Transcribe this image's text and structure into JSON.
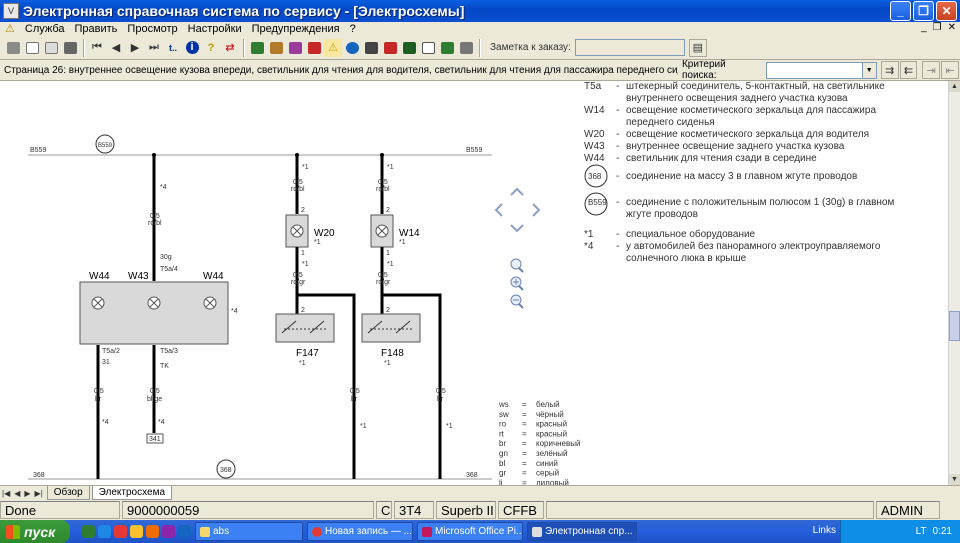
{
  "window": {
    "app_icon": "V",
    "title": "Электронная справочная система по сервису - [Электросхемы]",
    "minimize": "_",
    "restore": "❐",
    "close": "✕"
  },
  "menu": {
    "items": [
      "Служба",
      "Править",
      "Просмотр",
      "Настройки",
      "Предупреждения",
      "?"
    ],
    "mdi_min": "_",
    "mdi_restore": "❐",
    "mdi_close": "✕"
  },
  "toolbar": {
    "order_label": "Заметка к заказу:",
    "order_value": "",
    "icons": [
      "print-icon",
      "page-icon",
      "copy-icon",
      "car-icon",
      "first-icon",
      "prev-icon",
      "next-icon",
      "last-icon",
      "t-icon",
      "info-icon",
      "help-icon",
      "swap-icon",
      "doc-icon",
      "print2-icon",
      "tools-icon",
      "bulb-icon",
      "warning-icon",
      "globe-icon",
      "battery-icon",
      "oil-icon",
      "car2-icon",
      "check-icon",
      "edit-icon",
      "gauge-icon"
    ],
    "icon_glyphs": {
      "t": "t..",
      "info": "i",
      "help": "?"
    }
  },
  "infobar": {
    "page_text": "Страница 26: внутреннее освещение кузова впереди, светильник для чтения для водителя, светильник для чтения для пассажира переднего сиденья",
    "criteria_label": "Критерий поиска:",
    "criteria_value": ""
  },
  "diagram": {
    "b559_left": "B559",
    "b559_right": "B559",
    "b559_circle": "B559",
    "ground_left": "368",
    "ground_right": "368",
    "ground_circle": "368",
    "wires": {
      "w1_size": "0,5",
      "w1_color": "ro/bl",
      "w1_note": "*4",
      "w2_size": "0,5",
      "w2_color": "ro/bl",
      "w2_note": "*1",
      "w3_size": "0,5",
      "w3_color": "ro/bl",
      "w3_note": "*1",
      "w4_size": "0,5",
      "w4_color": "ro/gr",
      "w4_note": "*1",
      "w5_size": "0,5",
      "w5_color": "ro/gr",
      "w5_note": "*1",
      "w6_size": "0,5",
      "w6_color": "br",
      "w6_note": "*4",
      "w7_size": "0,5",
      "w7_color": "bl/ge",
      "w7_note": "*4",
      "w8_size": "0,5",
      "w8_color": "br",
      "w8_note": "*1",
      "w9_size": "0,5",
      "w9_color": "br",
      "w9_note": "*1"
    },
    "lamp_unit": {
      "w44_left": "W44",
      "w43": "W43",
      "w44_right": "W44",
      "connector_top": "T5a/4",
      "pin_top": "30g",
      "conn_left": "T5a/2",
      "pin_left": "31",
      "conn_right": "T5a/3",
      "pin_right": "TK",
      "note": "*4",
      "ref": "341"
    },
    "w20": {
      "label": "W20",
      "note": "*1",
      "pin_top": "2",
      "pin_bottom": "1"
    },
    "w14": {
      "label": "W14",
      "note": "*1",
      "pin_top": "2",
      "pin_bottom": "1"
    },
    "f147": {
      "label": "F147",
      "note": "*1",
      "pin_top": "2",
      "pin_bottom": "1"
    },
    "f148": {
      "label": "F148",
      "note": "*1",
      "pin_top": "2",
      "pin_bottom": "1"
    }
  },
  "legend": [
    {
      "code": "T5a",
      "dash": "-",
      "text": "штекерный соединитель, 5-контактный, на светильнике внутреннего освещения заднего участка кузова"
    },
    {
      "code": "W14",
      "dash": "-",
      "text": "освещение косметического зеркальца для пассажира переднего сиденья"
    },
    {
      "code": "W20",
      "dash": "-",
      "text": "освещение косметического зеркальца для водителя"
    },
    {
      "code": "W43",
      "dash": "-",
      "text": "внутреннее освещение заднего участка кузова"
    },
    {
      "code": "W44",
      "dash": "-",
      "text": "светильник для чтения сзади в середине"
    },
    {
      "code": "368",
      "dash": "-",
      "text": "соединение на массу 3 в главном жгуте проводов"
    },
    {
      "code": "B559",
      "dash": "-",
      "text": "соединение с положительным полюсом 1 (30g) в главном жгуте проводов"
    },
    {
      "code": "*1",
      "dash": "-",
      "text": "специальное оборудование"
    },
    {
      "code": "*4",
      "dash": "-",
      "text": "у автомобилей без панорамного электроуправляемого солнечного люка в крыше"
    }
  ],
  "colors": [
    {
      "code": "ws",
      "eq": "=",
      "name": "белый"
    },
    {
      "code": "sw",
      "eq": "=",
      "name": "чёрный"
    },
    {
      "code": "ro",
      "eq": "=",
      "name": "красный"
    },
    {
      "code": "rt",
      "eq": "=",
      "name": "красный"
    },
    {
      "code": "br",
      "eq": "=",
      "name": "коричневый"
    },
    {
      "code": "gn",
      "eq": "=",
      "name": "зелёный"
    },
    {
      "code": "bl",
      "eq": "=",
      "name": "синий"
    },
    {
      "code": "gr",
      "eq": "=",
      "name": "серый"
    },
    {
      "code": "li",
      "eq": "=",
      "name": "лиловый"
    }
  ],
  "tabs": {
    "overview": "Обзор",
    "schematic": "Электросхема"
  },
  "status": {
    "state": "Done",
    "number": "9000000059",
    "c": "C",
    "model_code": "3T4",
    "model": "Superb II",
    "engine": "CFFB",
    "empty": "",
    "user": "ADMIN"
  },
  "taskbar": {
    "start": "пуск",
    "tasks": [
      "abs",
      "Новая запись — ...",
      "Microsoft Office Pi...",
      "Электронная спр..."
    ],
    "links": "Links",
    "lang": "LT",
    "time": "0:21"
  },
  "accent": "#0b4fd2"
}
